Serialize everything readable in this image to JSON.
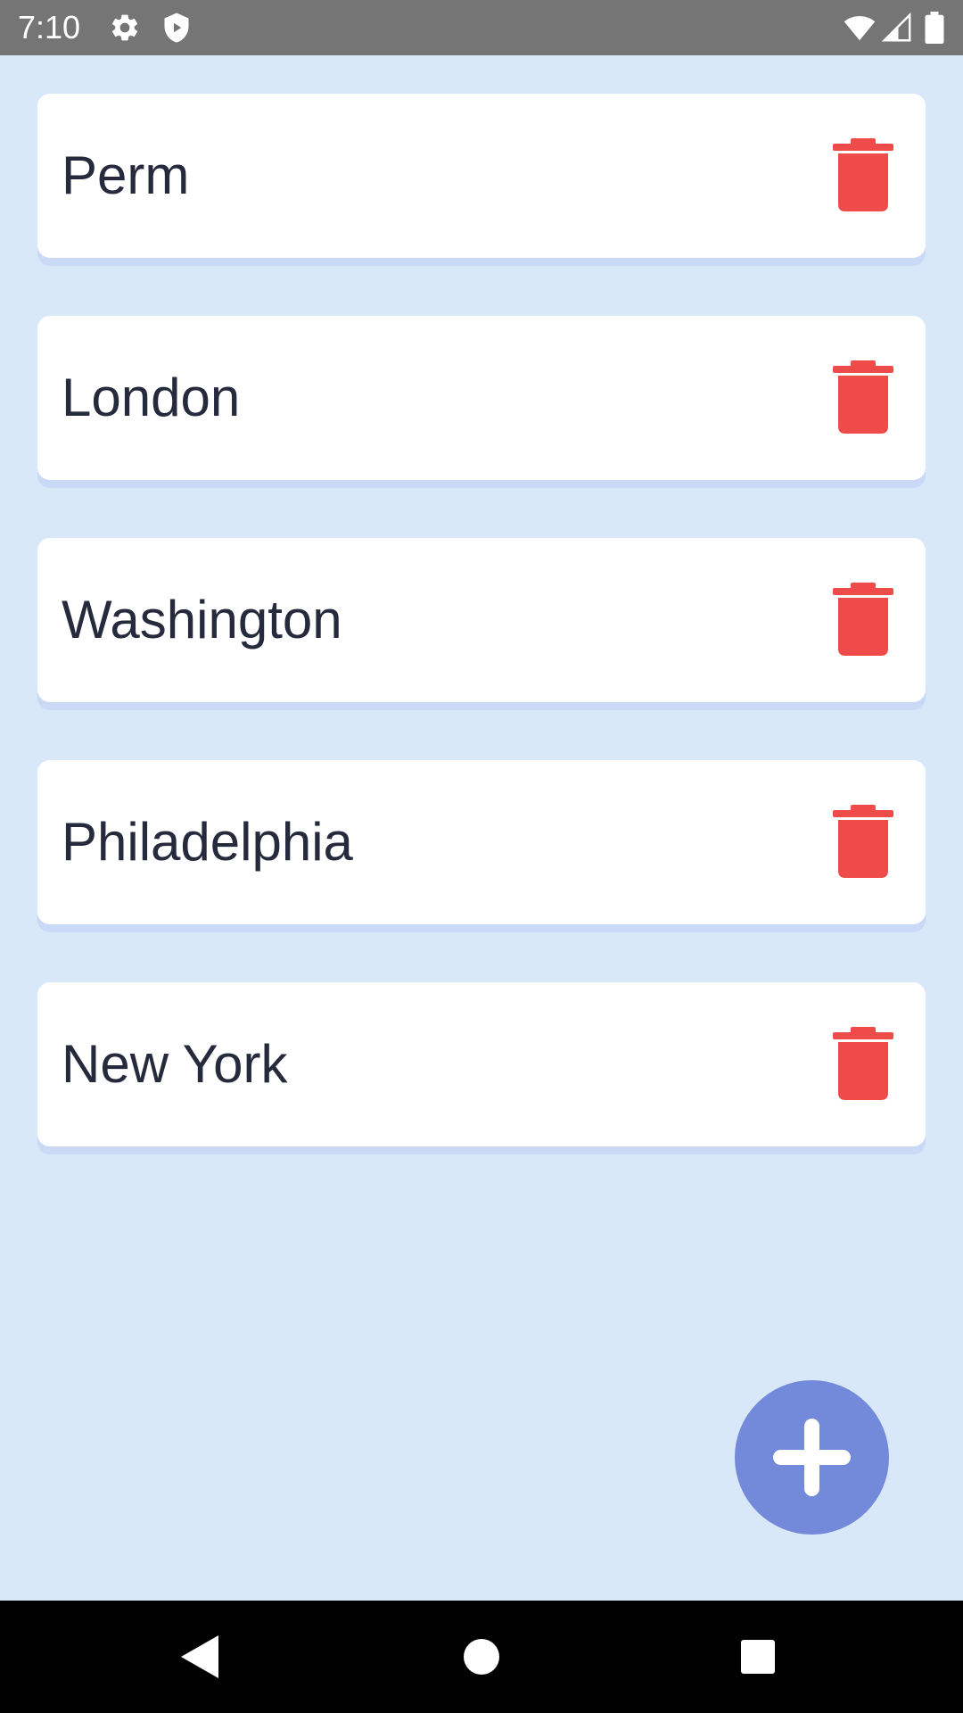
{
  "status_bar": {
    "time": "7:10",
    "left_icons": [
      "gear-icon",
      "shield-icon"
    ],
    "right_icons": [
      "wifi-icon",
      "cell-signal-icon",
      "battery-icon"
    ]
  },
  "cities": [
    {
      "name": "Perm",
      "delete_icon": "trash-icon"
    },
    {
      "name": "London",
      "delete_icon": "trash-icon"
    },
    {
      "name": "Washington",
      "delete_icon": "trash-icon"
    },
    {
      "name": "Philadelphia",
      "delete_icon": "trash-icon"
    },
    {
      "name": "New York",
      "delete_icon": "trash-icon"
    }
  ],
  "fab": {
    "icon": "plus-icon"
  },
  "nav_bar": {
    "buttons": [
      "back-icon",
      "home-icon",
      "recents-icon"
    ]
  },
  "colors": {
    "background": "#d9e8f8",
    "card": "#ffffff",
    "card_shadow": "#c9d9f6",
    "text": "#262a3d",
    "delete": "#ef4b4b",
    "fab": "#7389d9",
    "status_bar": "#757575",
    "nav_bar": "#000000"
  }
}
